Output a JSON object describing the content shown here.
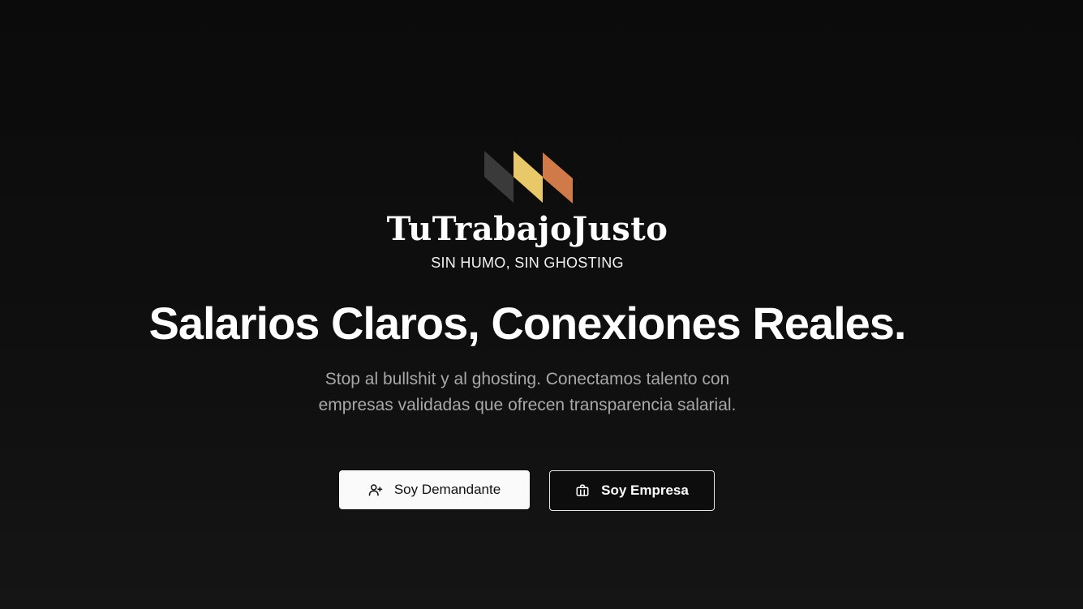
{
  "brand": {
    "name": "TuTrabajoJusto",
    "tagline": "SIN HUMO, SIN GHOSTING",
    "logo_colors": [
      "#3a3a3a",
      "#e9c86a",
      "#d07a4a"
    ]
  },
  "hero": {
    "headline": "Salarios Claros, Conexiones Reales.",
    "subtext": "Stop al bullshit y al ghosting. Conectamos talento con empresas validadas que ofrecen transparencia salarial."
  },
  "actions": {
    "primary": {
      "label": "Soy Demandante",
      "icon": "user-plus-icon"
    },
    "secondary": {
      "label": "Soy Empresa",
      "icon": "briefcase-icon"
    }
  },
  "colors": {
    "background": "#0f0f0f",
    "text": "#ffffff",
    "muted_text": "#a8a8a8",
    "primary_button_bg": "#fafafa"
  }
}
